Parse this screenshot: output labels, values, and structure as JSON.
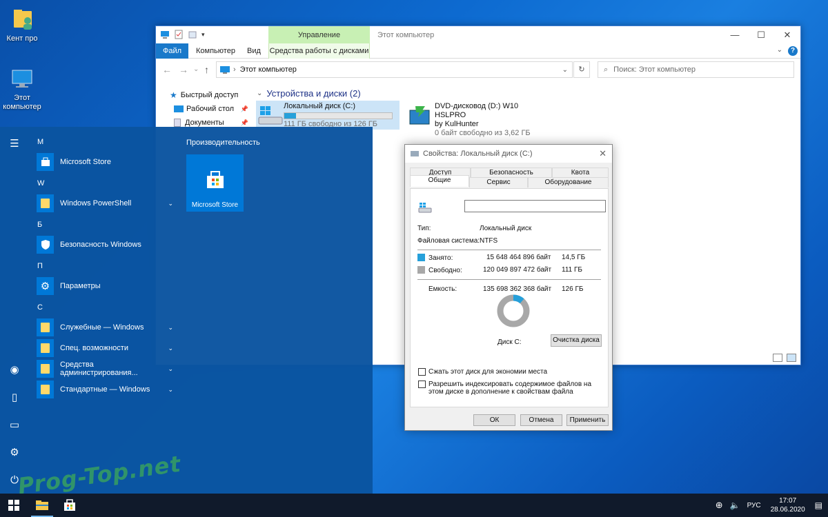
{
  "desktop": {
    "icons": [
      {
        "label": "Кент про",
        "icon": "user-folder-icon"
      },
      {
        "label": "Этот компьютер",
        "icon": "this-pc-icon"
      }
    ]
  },
  "explorer": {
    "title": "Этот компьютер",
    "context_tab": "Управление",
    "tabs": [
      "Файл",
      "Компьютер",
      "Вид",
      "Средства работы с дисками"
    ],
    "address": "Этот компьютер",
    "search_placeholder": "Поиск: Этот компьютер",
    "sidebar": [
      {
        "label": "Быстрый доступ",
        "icon": "star-icon",
        "pinned": false
      },
      {
        "label": "Рабочий стол",
        "icon": "desktop-icon",
        "pinned": true
      },
      {
        "label": "Документы",
        "icon": "documents-icon",
        "pinned": true
      }
    ],
    "group_header": "Устройства и диски (2)",
    "drives": [
      {
        "name": "Локальный диск (C:)",
        "free": "111 ГБ свободно из 126 ГБ",
        "used_fraction": 0.11,
        "icon": "windows-drive-icon"
      },
      {
        "name": "DVD-дисковод (D:) W10 HSLPRO",
        "label2": "by KulHunter",
        "free": "0 байт свободно из 3,62 ГБ",
        "icon": "dvd-setup-icon"
      }
    ]
  },
  "start_menu": {
    "tiles_header": "Производительность",
    "tile_label": "Microsoft Store",
    "apps": [
      {
        "letter": "M",
        "label": "Microsoft Store",
        "icon": "store-icon",
        "expand": false
      },
      {
        "letter": "W",
        "label": "Windows PowerShell",
        "icon": "folder-icon",
        "expand": true
      },
      {
        "letter": "Б",
        "label": "Безопасность Windows",
        "icon": "shield-icon",
        "expand": false
      },
      {
        "letter": "П",
        "label": "Параметры",
        "icon": "gear-icon",
        "expand": false
      },
      {
        "letter": "С",
        "label": "Служебные — Windows",
        "icon": "folder-icon",
        "expand": true
      },
      {
        "letter": "",
        "label": "Спец. возможности",
        "icon": "folder-icon",
        "expand": true
      },
      {
        "letter": "",
        "label": "Средства администрирования...",
        "icon": "folder-icon",
        "expand": true
      },
      {
        "letter": "",
        "label": "Стандартные — Windows",
        "icon": "folder-icon",
        "expand": true
      }
    ]
  },
  "dialog": {
    "title": "Свойства: Локальный диск (C:)",
    "tabs_row1": [
      "Доступ",
      "Безопасность",
      "Квота"
    ],
    "tabs_row2": [
      "Общие",
      "Сервис",
      "Оборудование"
    ],
    "type_label": "Тип:",
    "type_value": "Локальный диск",
    "fs_label": "Файловая система:",
    "fs_value": "NTFS",
    "used_label": "Занято:",
    "used_bytes": "15 648 464 896 байт",
    "used_gb": "14,5 ГБ",
    "free_label": "Свободно:",
    "free_bytes": "120 049 897 472 байт",
    "free_gb": "111 ГБ",
    "cap_label": "Емкость:",
    "cap_bytes": "135 698 362 368 байт",
    "cap_gb": "126 ГБ",
    "used_fraction": 0.115,
    "disk_label": "Диск C:",
    "cleanup_btn": "Очистка диска",
    "compress_label": "Сжать этот диск для экономии места",
    "index_label": "Разрешить индексировать содержимое файлов на этом диске в дополнение к свойствам файла",
    "ok": "ОК",
    "cancel": "Отмена",
    "apply": "Применить",
    "colors": {
      "used": "#26a0da",
      "free": "#a8a8a8"
    }
  },
  "taskbar": {
    "lang": "РУС",
    "time": "17:07",
    "date": "28.06.2020"
  },
  "watermark": "Prog-Top.net"
}
